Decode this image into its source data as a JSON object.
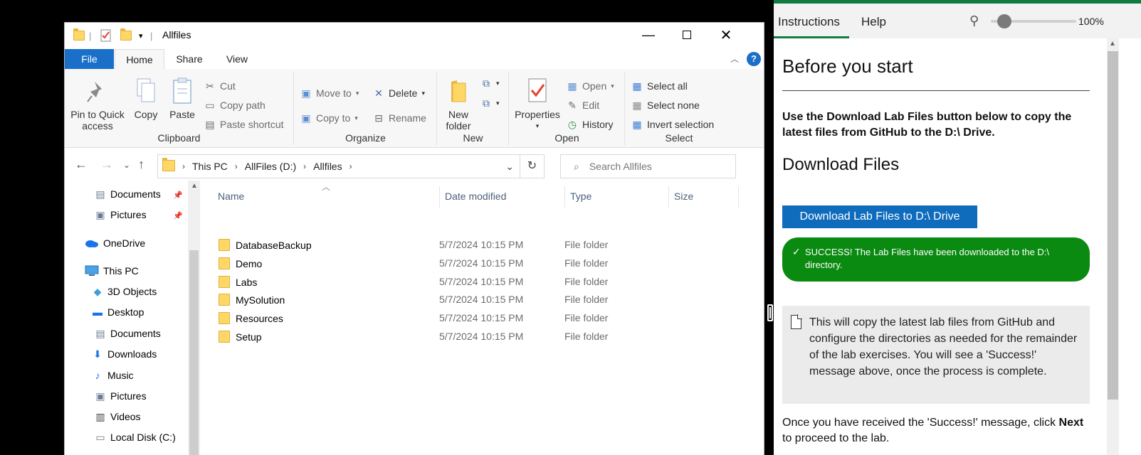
{
  "explorer": {
    "title": "Allfiles",
    "tabs": [
      "File",
      "Home",
      "Share",
      "View"
    ],
    "ribbon": {
      "clipboard": {
        "label": "Clipboard",
        "pin": "Pin to Quick access",
        "copy": "Copy",
        "paste": "Paste",
        "cut": "Cut",
        "copy_path": "Copy path",
        "paste_shortcut": "Paste shortcut"
      },
      "organize": {
        "label": "Organize",
        "move_to": "Move to",
        "copy_to": "Copy to",
        "delete": "Delete",
        "rename": "Rename"
      },
      "new": {
        "label": "New",
        "new_folder": "New folder"
      },
      "open": {
        "label": "Open",
        "properties": "Properties",
        "open": "Open",
        "edit": "Edit",
        "history": "History"
      },
      "select": {
        "label": "Select",
        "select_all": "Select all",
        "select_none": "Select none",
        "invert": "Invert selection"
      }
    },
    "address": {
      "crumbs": [
        "This PC",
        "AllFiles (D:)",
        "Allfiles"
      ],
      "search_placeholder": "Search Allfiles"
    },
    "nav": [
      {
        "label": "Documents",
        "icon": "documents-icon",
        "pinned": true
      },
      {
        "label": "Pictures",
        "icon": "pictures-icon",
        "pinned": true
      },
      {
        "label": "OneDrive",
        "icon": "onedrive-icon"
      },
      {
        "label": "This PC",
        "icon": "this-pc-icon"
      },
      {
        "label": "3D Objects",
        "icon": "3d-objects-icon"
      },
      {
        "label": "Desktop",
        "icon": "desktop-icon"
      },
      {
        "label": "Documents",
        "icon": "documents-icon"
      },
      {
        "label": "Downloads",
        "icon": "downloads-icon"
      },
      {
        "label": "Music",
        "icon": "music-icon"
      },
      {
        "label": "Pictures",
        "icon": "pictures-icon"
      },
      {
        "label": "Videos",
        "icon": "videos-icon"
      },
      {
        "label": "Local Disk (C:)",
        "icon": "local-disk-icon"
      }
    ],
    "columns": [
      "Name",
      "Date modified",
      "Type",
      "Size"
    ],
    "files": [
      {
        "name": "DatabaseBackup",
        "date": "5/7/2024 10:15 PM",
        "type": "File folder"
      },
      {
        "name": "Demo",
        "date": "5/7/2024 10:15 PM",
        "type": "File folder"
      },
      {
        "name": "Labs",
        "date": "5/7/2024 10:15 PM",
        "type": "File folder"
      },
      {
        "name": "MySolution",
        "date": "5/7/2024 10:15 PM",
        "type": "File folder"
      },
      {
        "name": "Resources",
        "date": "5/7/2024 10:15 PM",
        "type": "File folder"
      },
      {
        "name": "Setup",
        "date": "5/7/2024 10:15 PM",
        "type": "File folder"
      }
    ]
  },
  "lab": {
    "tabs": [
      "Instructions",
      "Help"
    ],
    "zoom": "100%",
    "heading": "Before you start",
    "intro": "Use the Download Lab Files button below to copy the latest files from GitHub to the D:\\ Drive.",
    "subheading": "Download Files",
    "download_button": "Download Lab Files to D:\\ Drive",
    "success": "SUCCESS! The Lab Files have been downloaded to the D:\\ directory.",
    "note": "This will copy the latest lab files from GitHub and configure the directories as needed for the remainder of the lab exercises. You will see a 'Success!' message above, once the process is complete.",
    "final_text_before": "Once you have received the 'Success!' message, click",
    "final_bold": "Next",
    "final_text_after": "to proceed to the lab.",
    "accent_color": "#107c41",
    "button_color": "#0f6cbd",
    "success_color": "#0a8a10"
  }
}
